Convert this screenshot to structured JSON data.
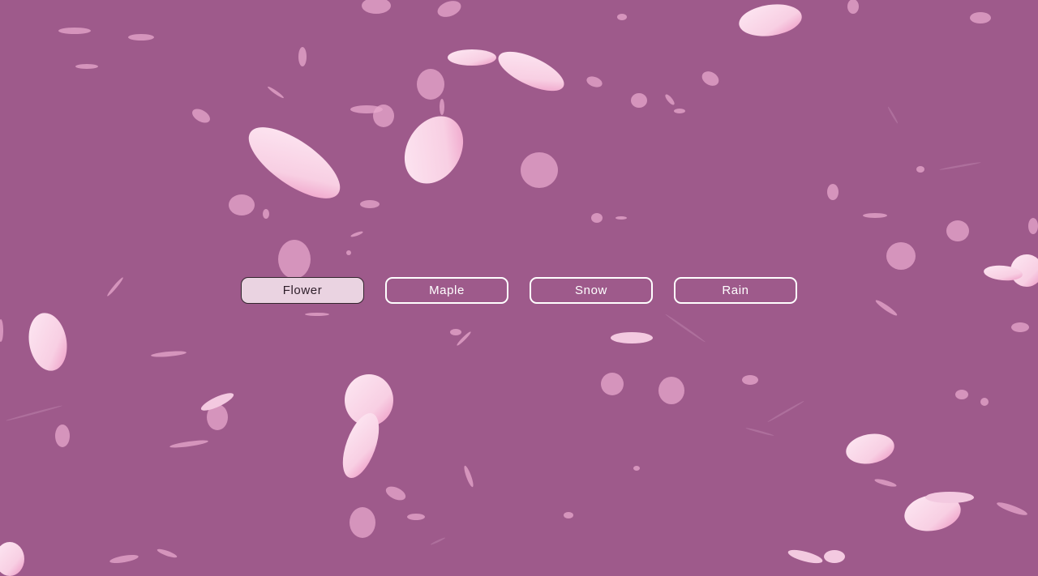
{
  "scene": {
    "background_color": "#9e5a8b",
    "petal_color": "#fbd8ea",
    "petal_tip_color": "#f0a3c9",
    "active_mode": "Flower"
  },
  "modes": [
    {
      "label": "Flower",
      "selected": true
    },
    {
      "label": "Maple",
      "selected": false
    },
    {
      "label": "Snow",
      "selected": false
    },
    {
      "label": "Rain",
      "selected": false
    }
  ]
}
